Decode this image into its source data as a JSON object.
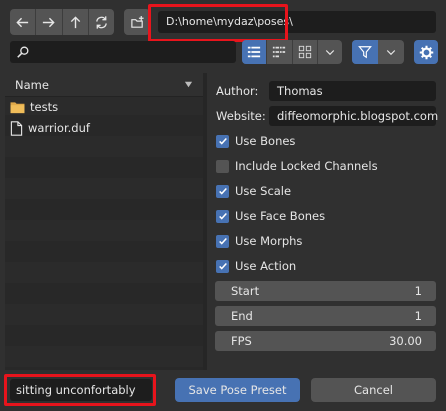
{
  "toolbar": {
    "nav_icons": [
      "arrow-left-icon",
      "arrow-right-icon",
      "arrow-up-icon",
      "refresh-icon"
    ],
    "new_folder_icon": "new-folder-icon",
    "path": "D:\\home\\mydaz\\poses\\",
    "search_value": "",
    "display_modes": [
      "vertical-list-icon",
      "horizontal-list-icon",
      "thumbnails-icon"
    ],
    "active_display_mode": "vertical-list-icon"
  },
  "file_list": {
    "column_header": "Name",
    "items": [
      {
        "name": "tests",
        "type": "folder"
      },
      {
        "name": "warrior.duf",
        "type": "file"
      }
    ]
  },
  "options": {
    "author_label": "Author:",
    "author_value": "Thomas",
    "website_label": "Website:",
    "website_value": "diffeomorphic.blogspot.com",
    "checkboxes": [
      {
        "label": "Use Bones",
        "checked": true
      },
      {
        "label": "Include Locked Channels",
        "checked": false
      },
      {
        "label": "Use Scale",
        "checked": true
      },
      {
        "label": "Use Face Bones",
        "checked": true
      },
      {
        "label": "Use Morphs",
        "checked": true
      },
      {
        "label": "Use Action",
        "checked": true
      }
    ],
    "start_label": "Start",
    "start_value": "1",
    "end_label": "End",
    "end_value": "1",
    "fps_label": "FPS",
    "fps_value": "30.00"
  },
  "bottom": {
    "filename": "sitting unconfortably",
    "save_label": "Save Pose Preset",
    "cancel_label": "Cancel"
  },
  "colors": {
    "accent": "#4772b3",
    "highlight": "#e8141c",
    "background": "#303030"
  }
}
